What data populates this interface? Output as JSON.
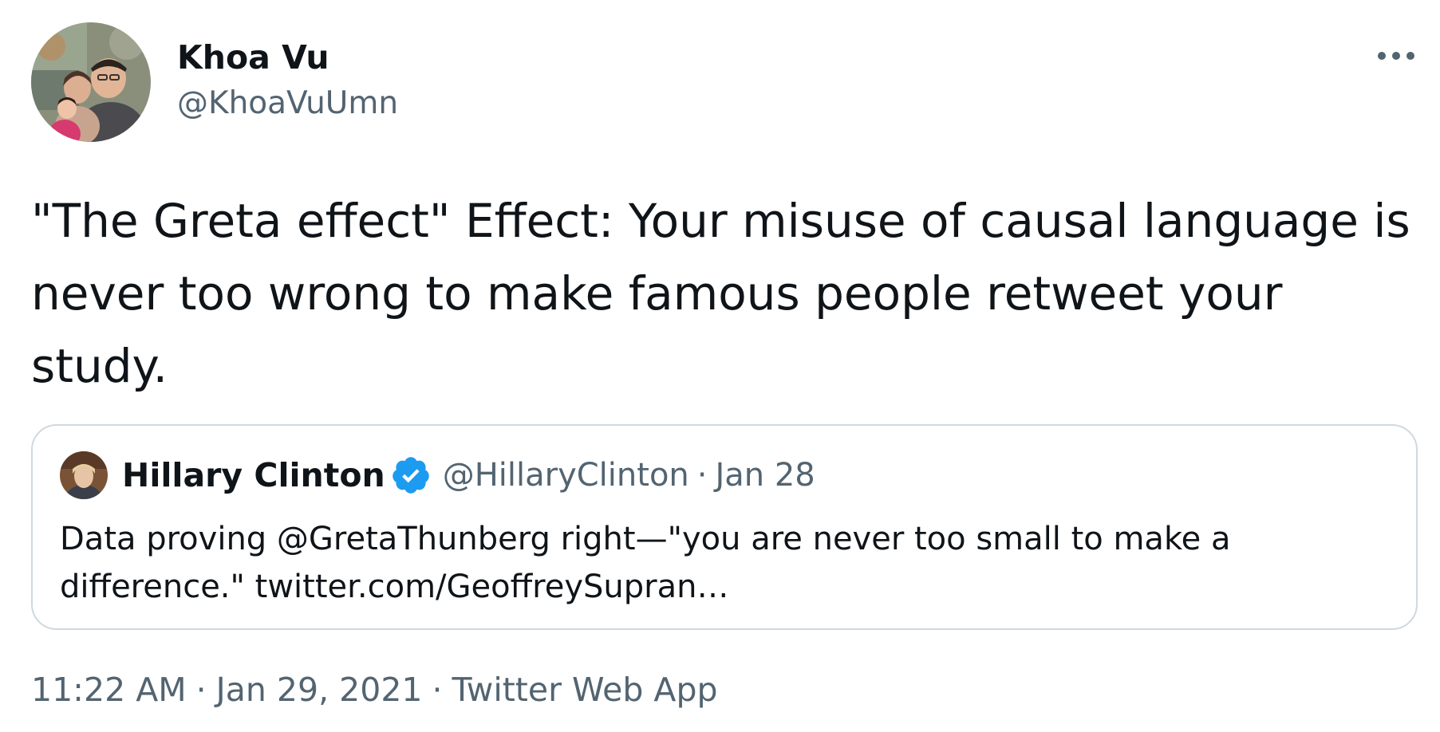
{
  "author": {
    "name": "Khoa Vu",
    "handle": "@KhoaVuUmn",
    "avatar_icon": "family-photo-avatar"
  },
  "more_icon": "more-horizontal-icon",
  "tweet_text": "\"The Greta effect\" Effect: Your misuse of causal language is never too wrong to make famous people retweet your study.",
  "quoted_tweet": {
    "name": "Hillary Clinton",
    "verified_icon": "verified-badge-icon",
    "handle": "@HillaryClinton",
    "separator": "·",
    "date": "Jan 28",
    "text": "Data proving @GretaThunberg right—\"you are never too small to make a difference.\" twitter.com/GeoffreySupran…"
  },
  "meta": {
    "time": "11:22 AM",
    "separator": "·",
    "date": "Jan 29, 2021",
    "source": "Twitter Web App"
  },
  "colors": {
    "text_primary": "#0f1419",
    "text_secondary": "#536471",
    "border": "#cfd9de",
    "verified_blue": "#1d9bf0"
  }
}
